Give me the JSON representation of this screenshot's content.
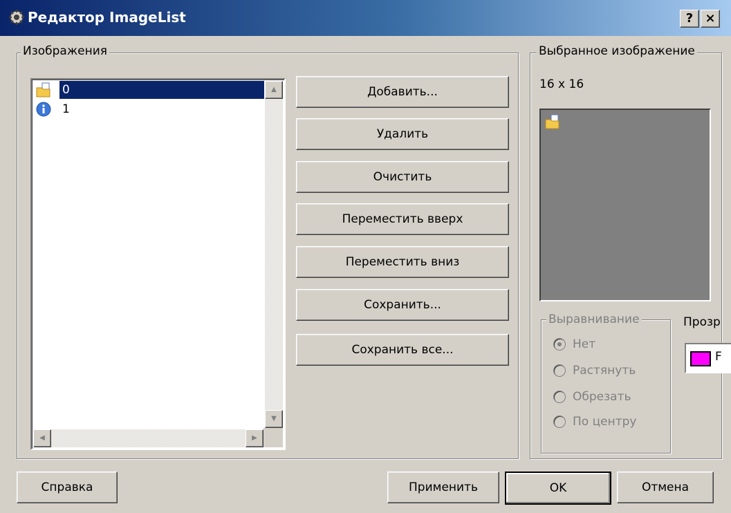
{
  "window": {
    "title": "Редактор ImageList",
    "help_button": "?",
    "close_button": "×"
  },
  "images_group": {
    "legend": "Изображения",
    "items": [
      {
        "label": "0",
        "icon": "folder-page-icon",
        "selected": true
      },
      {
        "label": "1",
        "icon": "info-icon",
        "selected": false
      }
    ]
  },
  "actions": {
    "add": "Добавить...",
    "delete": "Удалить",
    "clear": "Очистить",
    "move_up": "Переместить вверх",
    "move_down": "Переместить вниз",
    "save": "Сохранить...",
    "save_all": "Сохранить все..."
  },
  "selected_group": {
    "legend": "Выбранное изображение",
    "size": "16 x 16",
    "preview_icon": "folder-page-icon",
    "alignment": {
      "legend": "Выравнивание",
      "options": [
        "Нет",
        "Растянуть",
        "Обрезать",
        "По центру"
      ],
      "selected": "Нет"
    },
    "transparent": {
      "label": "Прозр",
      "color": "#ff00ff",
      "value_partial": "F"
    }
  },
  "footer": {
    "help": "Справка",
    "apply": "Применить",
    "ok": "OK",
    "cancel": "Отмена"
  },
  "colors": {
    "title_gradient_start": "#0a246a",
    "title_gradient_end": "#a6caf0",
    "selection": "#0a246a",
    "dialog_bg": "#d4d0c8",
    "preview_bg": "#808080"
  }
}
